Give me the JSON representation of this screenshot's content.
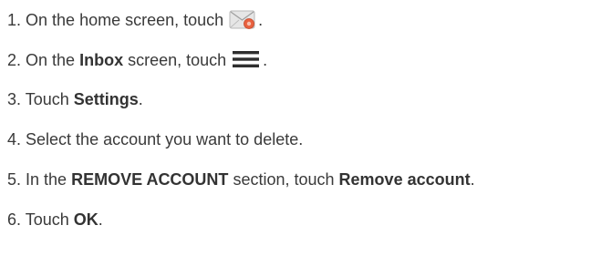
{
  "steps": [
    {
      "num": "1.",
      "pre": "On the home screen, touch",
      "post": ".",
      "icon": "email-icon"
    },
    {
      "num": "2.",
      "pre": "On the",
      "bold1": "Inbox",
      "mid": "screen, touch",
      "post": ".",
      "icon": "menu-icon"
    },
    {
      "num": "3.",
      "pre": "Touch",
      "bold1": "Settings",
      "post": "."
    },
    {
      "num": "4.",
      "text": "Select the account you want to delete."
    },
    {
      "num": "5.",
      "pre": "In the",
      "bold1": "REMOVE ACCOUNT",
      "mid": "section, touch",
      "bold2": "Remove account",
      "post": "."
    },
    {
      "num": "6.",
      "pre": "Touch",
      "bold1": "OK",
      "post": "."
    }
  ],
  "colors": {
    "text": "#3a3a3a",
    "menu_icon": "#2e2e2e",
    "email_envelope": "#dcdcdc",
    "email_badge": "#e05a3a"
  }
}
